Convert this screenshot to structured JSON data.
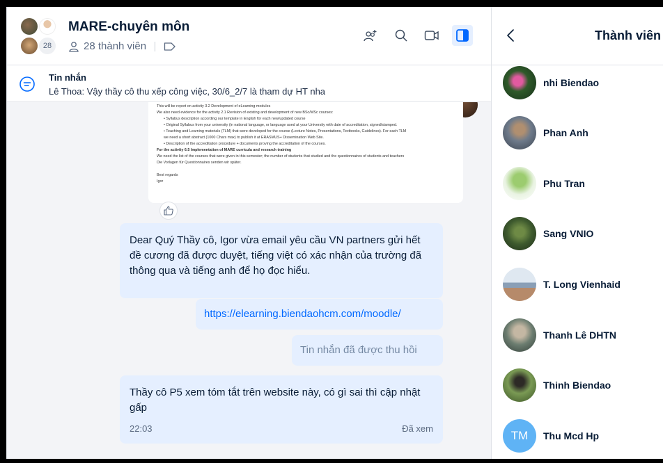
{
  "header": {
    "group_title": "MARE-chuyên môn",
    "avatar_count": "28",
    "member_count_label": "28 thành viên"
  },
  "pinned": {
    "title": "Tin nhắn",
    "text": "Lê Thoa: Vậy thầy cô thu xếp công việc, 30/6_2/7 là tham dự HT nha"
  },
  "document": {
    "lines": [
      "This will be report on activity 3.2 Development of eLearning modules",
      "We also need evidence for the activity  2.1 Revision of existing and development of new BSc/MSc courses:",
      "• Syllabus description according our template in English for each new/updated course",
      "• Original Syllabus from your university (in national language, or language used at your University with date of accreditation, signed/stamped.",
      "• Teaching and Learning materials (TLM) that were developed for the course (Lecture Notes, Presentations, Textbooks, Guidelines). For each TLM",
      "  we need a short abstract (1000 Chars max) to publish it at ERASMUS+ Dissemination Web Site.",
      "• Description of the accreditation procedure + documents proving the accreditation of the courses.",
      "For the activity    6.5 Implementation of MARE curricula and research training",
      "We need the list of the courses that were given in this semester; the number of students that studied and the questionnaires of students and teachers",
      "Die Vorlagen für Questionnaires  senden wir später.",
      "",
      "Best regards",
      "Igor"
    ]
  },
  "messages": [
    {
      "text": "Dear Quý Thầy cô, Igor vừa email yêu cầu VN partners gửi hết đề cương đã được duyệt, tiếng việt có xác nhận của trường đã thông qua và tiếng anh để họ đọc hiểu."
    },
    {
      "text": "https://elearning.biendaohcm.com/moodle/"
    },
    {
      "text": "Tin nhắn đã được thu hồi"
    },
    {
      "text": "Thầy cô P5 xem tóm tắt trên website này, có gì sai thì cập nhật gấp",
      "time": "22:03",
      "status": "Đã xem"
    }
  ],
  "panel": {
    "title": "Thành viên",
    "members": [
      {
        "name": "nhi Biendao",
        "color": "#b23a78"
      },
      {
        "name": "Phan Anh",
        "color": "#7a6b5a"
      },
      {
        "name": "Phu Tran",
        "color": "#8fbf6a"
      },
      {
        "name": "Sang VNIO",
        "color": "#4d6b3a"
      },
      {
        "name": "T. Long Vienhaid",
        "color": "#9cb3c8"
      },
      {
        "name": "Thanh Lê DHTN",
        "color": "#5b6d7a"
      },
      {
        "name": "Thinh Biendao",
        "color": "#5a7044"
      },
      {
        "name": "Thu Mcd Hp",
        "initials": "TM",
        "color": "#5fb3f5"
      }
    ]
  }
}
